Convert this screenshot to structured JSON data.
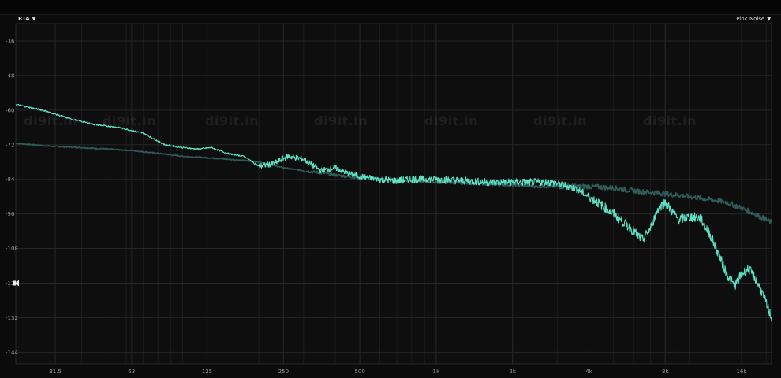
{
  "controls": {
    "analyzer_mode": "RTA",
    "signal_source": "Pink Noise"
  },
  "watermark": "di9it.in",
  "colors": {
    "background": "#0b0b0b",
    "grid": "#262626",
    "axis_text": "#9a9a9a",
    "trace_measured": "#5fe0c4",
    "trace_reference": "#2f5b58"
  },
  "chart_data": {
    "type": "line",
    "x_scale": "log",
    "xlim": [
      22,
      21000
    ],
    "ylim": [
      -148,
      -30
    ],
    "grid": true,
    "x_ticks": [
      {
        "value": 31.5,
        "label": "31.5"
      },
      {
        "value": 63,
        "label": "63"
      },
      {
        "value": 125,
        "label": "125"
      },
      {
        "value": 250,
        "label": "250"
      },
      {
        "value": 500,
        "label": "500"
      },
      {
        "value": 1000,
        "label": "1k"
      },
      {
        "value": 2000,
        "label": "2k"
      },
      {
        "value": 4000,
        "label": "4k"
      },
      {
        "value": 8000,
        "label": "8k"
      },
      {
        "value": 16000,
        "label": "16k"
      }
    ],
    "y_ticks": [
      {
        "value": -36,
        "label": "-36"
      },
      {
        "value": -48,
        "label": "-48"
      },
      {
        "value": -60,
        "label": "-60"
      },
      {
        "value": -72,
        "label": "-72"
      },
      {
        "value": -84,
        "label": "-84"
      },
      {
        "value": -96,
        "label": "-96"
      },
      {
        "value": -108,
        "label": "-108"
      },
      {
        "value": -120,
        "label": "-120"
      },
      {
        "value": -132,
        "label": "-132"
      },
      {
        "value": -144,
        "label": "-144"
      }
    ],
    "y_marker": -120,
    "series": [
      {
        "x": [
          22,
          28,
          36,
          45,
          56,
          70,
          85,
          100,
          115,
          130,
          150,
          175,
          200,
          230,
          260,
          300,
          350,
          400,
          450,
          500,
          600,
          700,
          800,
          1000,
          1300,
          1600,
          2000,
          2400,
          2800,
          3200,
          3600,
          4000,
          4500,
          5000,
          5500,
          6000,
          6500,
          7000,
          7500,
          8000,
          8500,
          9000,
          10000,
          11000,
          12000,
          13000,
          14000,
          15000,
          16000,
          17000,
          18000,
          19000,
          20000,
          21000
        ],
        "y": [
          -58,
          -60,
          -63,
          -65,
          -66,
          -68,
          -72,
          -73,
          -73.5,
          -73,
          -75,
          -76,
          -79.5,
          -78.5,
          -76,
          -77,
          -81,
          -80,
          -82,
          -83,
          -84,
          -84.5,
          -84,
          -84,
          -84.5,
          -85,
          -85,
          -85,
          -85,
          -86,
          -87.5,
          -90,
          -93,
          -96,
          -99,
          -102,
          -105,
          -101,
          -94,
          -92,
          -95,
          -98,
          -97,
          -97.5,
          -103,
          -110,
          -117,
          -121,
          -117,
          -115,
          -118,
          -122,
          -127,
          -132
        ]
      },
      {
        "x": [
          22,
          30,
          40,
          50,
          63,
          80,
          100,
          125,
          150,
          175,
          200,
          250,
          300,
          400,
          500,
          600,
          800,
          1000,
          1500,
          2000,
          2500,
          3000,
          3500,
          4000,
          5000,
          6000,
          7000,
          8000,
          9000,
          10000,
          11000,
          12000,
          13000,
          14000,
          15000,
          16000,
          17000,
          18000,
          19000,
          20000,
          21000
        ],
        "y": [
          -71.5,
          -72.5,
          -73,
          -73.5,
          -74,
          -75,
          -76,
          -76.5,
          -77,
          -77.5,
          -78,
          -80,
          -81,
          -82.5,
          -83.5,
          -84,
          -84.5,
          -85,
          -85.5,
          -86,
          -86.5,
          -86.5,
          -86.5,
          -86.5,
          -87,
          -88,
          -88.5,
          -89,
          -89.5,
          -90,
          -90.5,
          -91,
          -91.5,
          -92,
          -93,
          -94,
          -95,
          -96,
          -97,
          -98,
          -99
        ]
      }
    ]
  }
}
